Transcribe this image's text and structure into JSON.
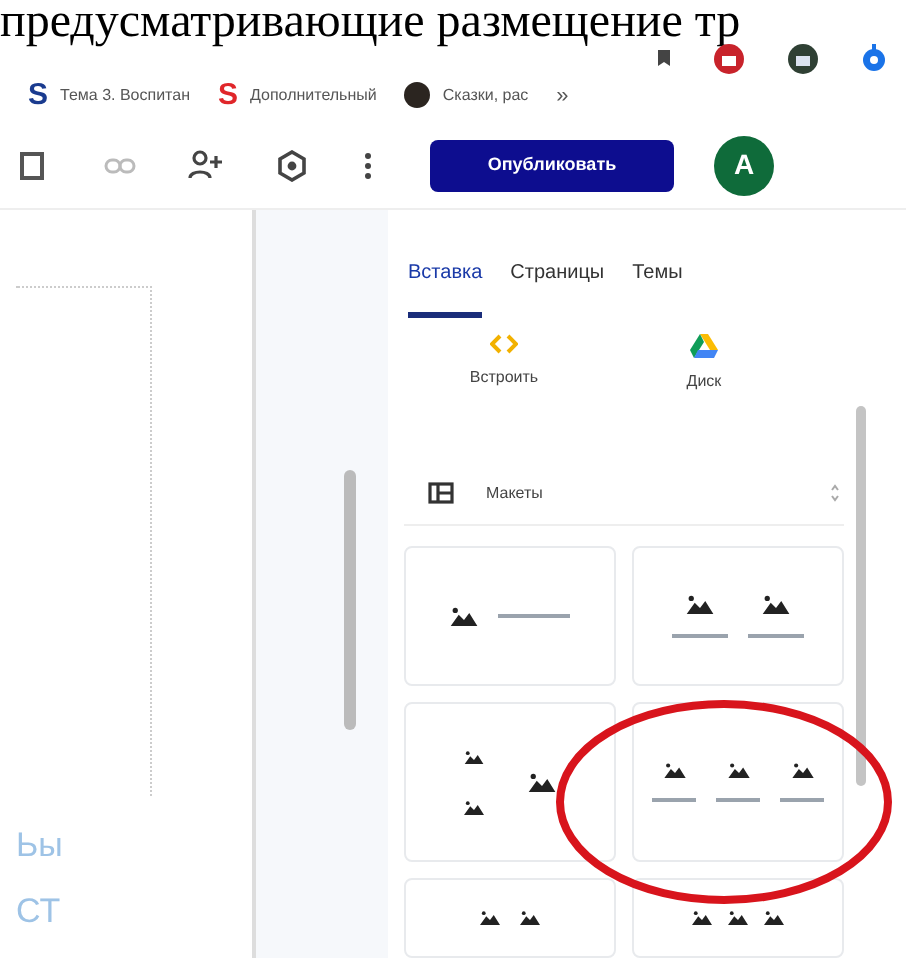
{
  "heading": "предусматривающие размещение тр",
  "bookmarks": [
    {
      "label": "Тема 3. Воспитан",
      "kind": "site",
      "logo": "S",
      "color": "#1a3b8f"
    },
    {
      "label": "Дополнительный",
      "kind": "site",
      "logo": "S",
      "color": "#e0262a"
    },
    {
      "label": "Сказки, рас",
      "kind": "ball",
      "color": "#2b2520"
    }
  ],
  "bookmarks_more": "»",
  "toolbar": {
    "publish": "Опубликовать",
    "avatar": "A"
  },
  "canvas_texts": [
    "Ьы",
    "СТ"
  ],
  "tabs": [
    {
      "label": "Вставка",
      "selected": true
    },
    {
      "label": "Страницы",
      "selected": false
    },
    {
      "label": "Темы",
      "selected": false
    }
  ],
  "insert_items": [
    {
      "label": "Встроить",
      "kind": "embed"
    },
    {
      "label": "Диск",
      "kind": "drive"
    }
  ],
  "layouts": {
    "title": "Макеты"
  }
}
